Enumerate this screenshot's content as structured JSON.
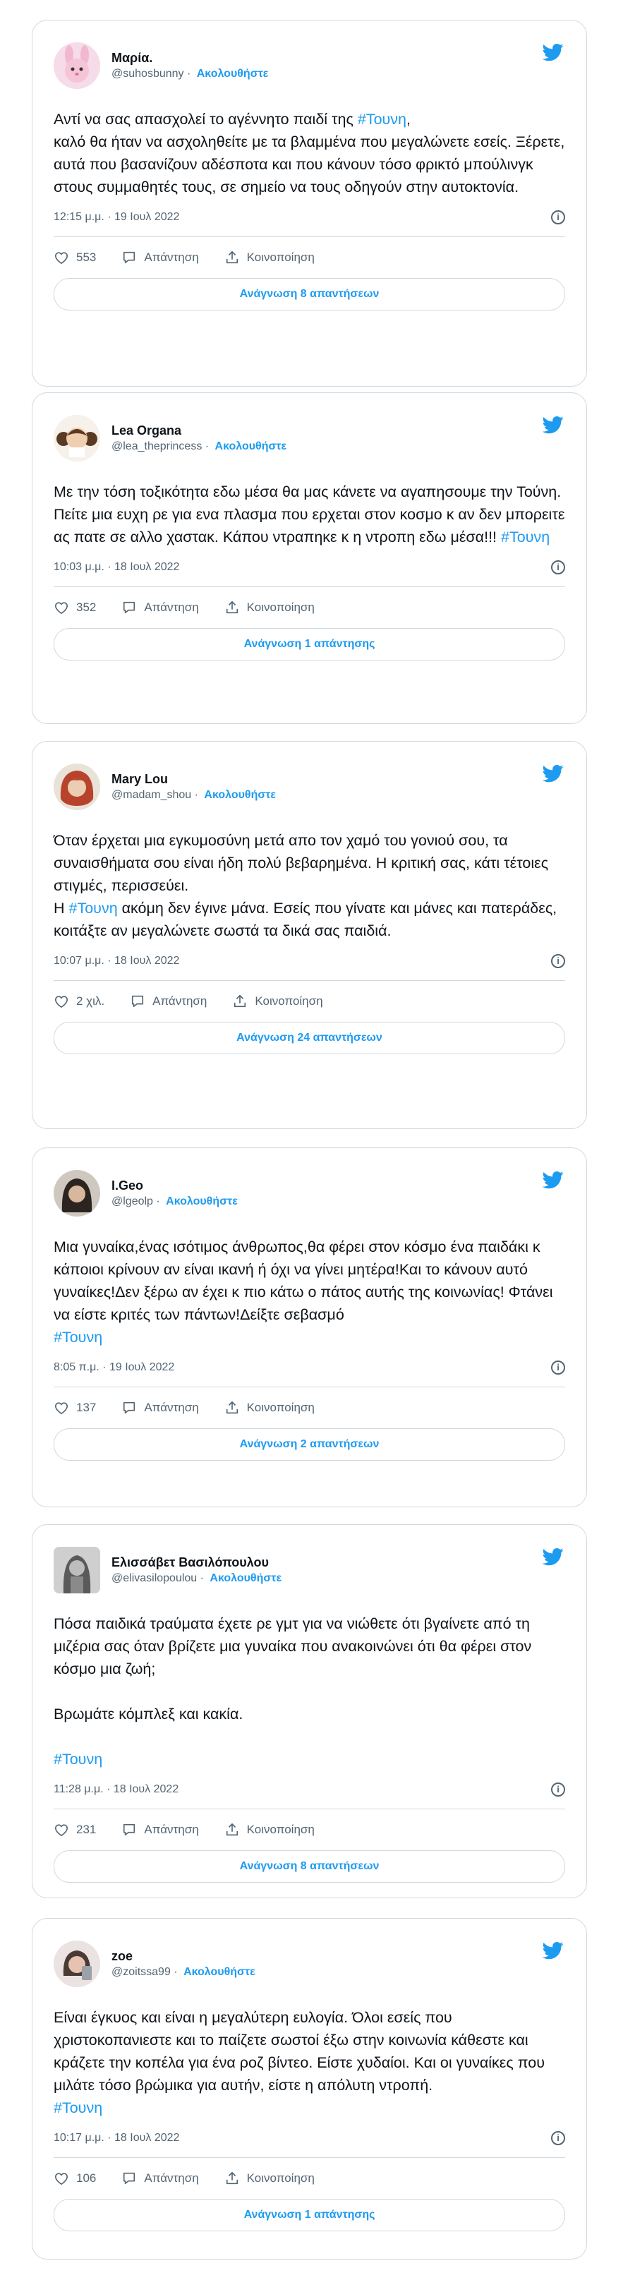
{
  "colors": {
    "accent": "#1d9bf0",
    "muted": "#536471",
    "border": "#cfd9de"
  },
  "tweets": [
    {
      "name": "Μαρία.",
      "handle": "@suhosbunny",
      "follow": "Ακολουθήστε",
      "body": "Αντί να σας απασχολεί το αγέννητο παιδί της ",
      "hashtag": "#Τουνη",
      "body_after": ",\nκαλό θα ήταν να ασχοληθείτε με τα βλαμμένα που μεγαλώνετε εσείς. Ξέρετε, αυτά που βασανίζουν αδέσποτα και που κάνουν τόσο φρικτό μπούλινγκ στους συμμαθητές τους, σε σημείο να τους οδηγούν στην αυτοκτονία.",
      "time": "12:15 μ.μ. · 19 Ιουλ 2022",
      "likes": "553",
      "reply_label": "Απάντηση",
      "share_label": "Κοινοποίηση",
      "replies_button": "Ανάγνωση 8 απαντήσεων",
      "avatar_icon": "pink-bunny-icon"
    },
    {
      "name": "Lea Organa",
      "handle": "@lea_theprincess",
      "follow": "Ακολουθήστε",
      "body": "Με την τόση τοξικότητα εδω μέσα θα μας κάνετε να αγαπησουμε την Τούνη. Πείτε μια ευχη ρε για ενα πλασμα που ερχεται στον κοσμο κ αν δεν μπορειτε ας πατε σε αλλο χαστακ. Κάπου ντραπηκε κ η ντροπη εδω μέσα!!! ",
      "hashtag": "#Τουνη",
      "body_after": "",
      "time": "10:03 μ.μ. · 18 Ιουλ 2022",
      "likes": "352",
      "reply_label": "Απάντηση",
      "share_label": "Κοινοποίηση",
      "replies_button": "Ανάγνωση 1 απάντησης",
      "avatar_icon": "princess-leia-icon"
    },
    {
      "name": "Mary Lou",
      "handle": "@madam_shou",
      "follow": "Ακολουθήστε",
      "body": "Όταν έρχεται μια εγκυμοσύνη μετά απο τον χαμό του γονιού σου, τα συναισθήματα σου είναι ήδη πολύ βεβαρημένα. Η κριτική σας, κάτι τέτοιες στιγμές, περισσεύει.\nΗ ",
      "hashtag": "#Τουνη",
      "body_after": " ακόμη δεν έγινε μάνα. Εσείς που γίνατε και μάνες και πατεράδες, κοιτάξτε αν μεγαλώνετε σωστά τα δικά σας παιδιά.",
      "time": "10:07 μ.μ. · 18 Ιουλ 2022",
      "likes": "2 χιλ.",
      "reply_label": "Απάντηση",
      "share_label": "Κοινοποίηση",
      "replies_button": "Ανάγνωση 24 απαντήσεων",
      "avatar_icon": "red-hair-avatar-icon"
    },
    {
      "name": "I.Geo",
      "handle": "@lgeolp",
      "follow": "Ακολουθήστε",
      "body": "Μια γυναίκα,ένας ισότιμος άνθρωπος,θα φέρει στον κόσμο ένα παιδάκι κ κάποιοι κρίνουν αν είναι ικανή ή όχι να γίνει μητέρα!Και το κάνουν αυτό γυναίκες!Δεν ξέρω αν έχει κ πιο κάτω ο πάτος αυτής της κοινωνίας! Φτάνει να είστε κριτές των πάντων!Δείξτε σεβασμό\n",
      "hashtag": "#Τουνη",
      "body_after": "",
      "time": "8:05 π.μ. · 19 Ιουλ 2022",
      "likes": "137",
      "reply_label": "Απάντηση",
      "share_label": "Κοινοποίηση",
      "replies_button": "Ανάγνωση 2 απαντήσεων",
      "avatar_icon": "dark-hair-avatar-icon"
    },
    {
      "name": "Ελισσάβετ Βασιλόπουλου",
      "handle": "@elivasilopoulou",
      "follow": "Ακολουθήστε",
      "body": "Πόσα παιδικά τραύματα έχετε ρε γμτ για να νιώθετε ότι βγαίνετε από τη μιζέρια σας όταν βρίζετε μια γυναίκα που ανακοινώνει ότι θα φέρει στον κόσμο μια ζωή;\n\nΒρωμάτε κόμπλεξ και κακία.\n\n",
      "hashtag": "#Τουνη",
      "body_after": "",
      "time": "11:28 μ.μ. · 18 Ιουλ 2022",
      "likes": "231",
      "reply_label": "Απάντηση",
      "share_label": "Κοινοποίηση",
      "replies_button": "Ανάγνωση 8 απαντήσεων",
      "avatar_icon": "grayscale-portrait-icon"
    },
    {
      "name": "zoe",
      "handle": "@zoitssa99",
      "follow": "Ακολουθήστε",
      "body": "Είναι έγκυος και είναι η μεγαλύτερη ευλογία. Όλοι εσείς που χριστοκοπανιεστε και το παίζετε σωστοί έξω στην κοινωνία κάθεστε και κράζετε την κοπέλα για ένα ροζ βίντεο. Είστε χυδαίοι. Και οι γυναίκες που μιλάτε τόσο βρώμικα για αυτήν, είστε η απόλυτη ντροπή.\n",
      "hashtag": "#Τουνη",
      "body_after": "",
      "time": "10:17 μ.μ. · 18 Ιουλ 2022",
      "likes": "106",
      "reply_label": "Απάντηση",
      "share_label": "Κοινοποίηση",
      "replies_button": "Ανάγνωση 1 απάντησης",
      "avatar_icon": "selfie-avatar-icon"
    }
  ]
}
